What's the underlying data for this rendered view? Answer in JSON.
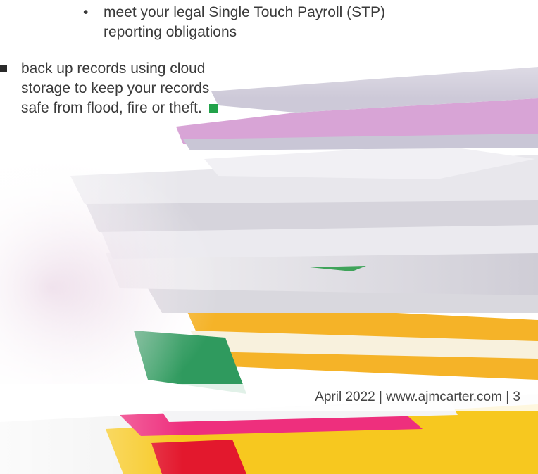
{
  "sub_bullet": {
    "marker": "•",
    "text": "meet your legal Single Touch Payroll (STP) reporting obligations"
  },
  "main_bullet": {
    "text": "back up records using cloud storage to keep your records safe from flood, fire or theft."
  },
  "colors": {
    "end_mark": "#22a24a",
    "body_text": "#3a3a3a"
  },
  "footer": {
    "text": "April 2022 | www.ajmcarter.com | 3"
  }
}
